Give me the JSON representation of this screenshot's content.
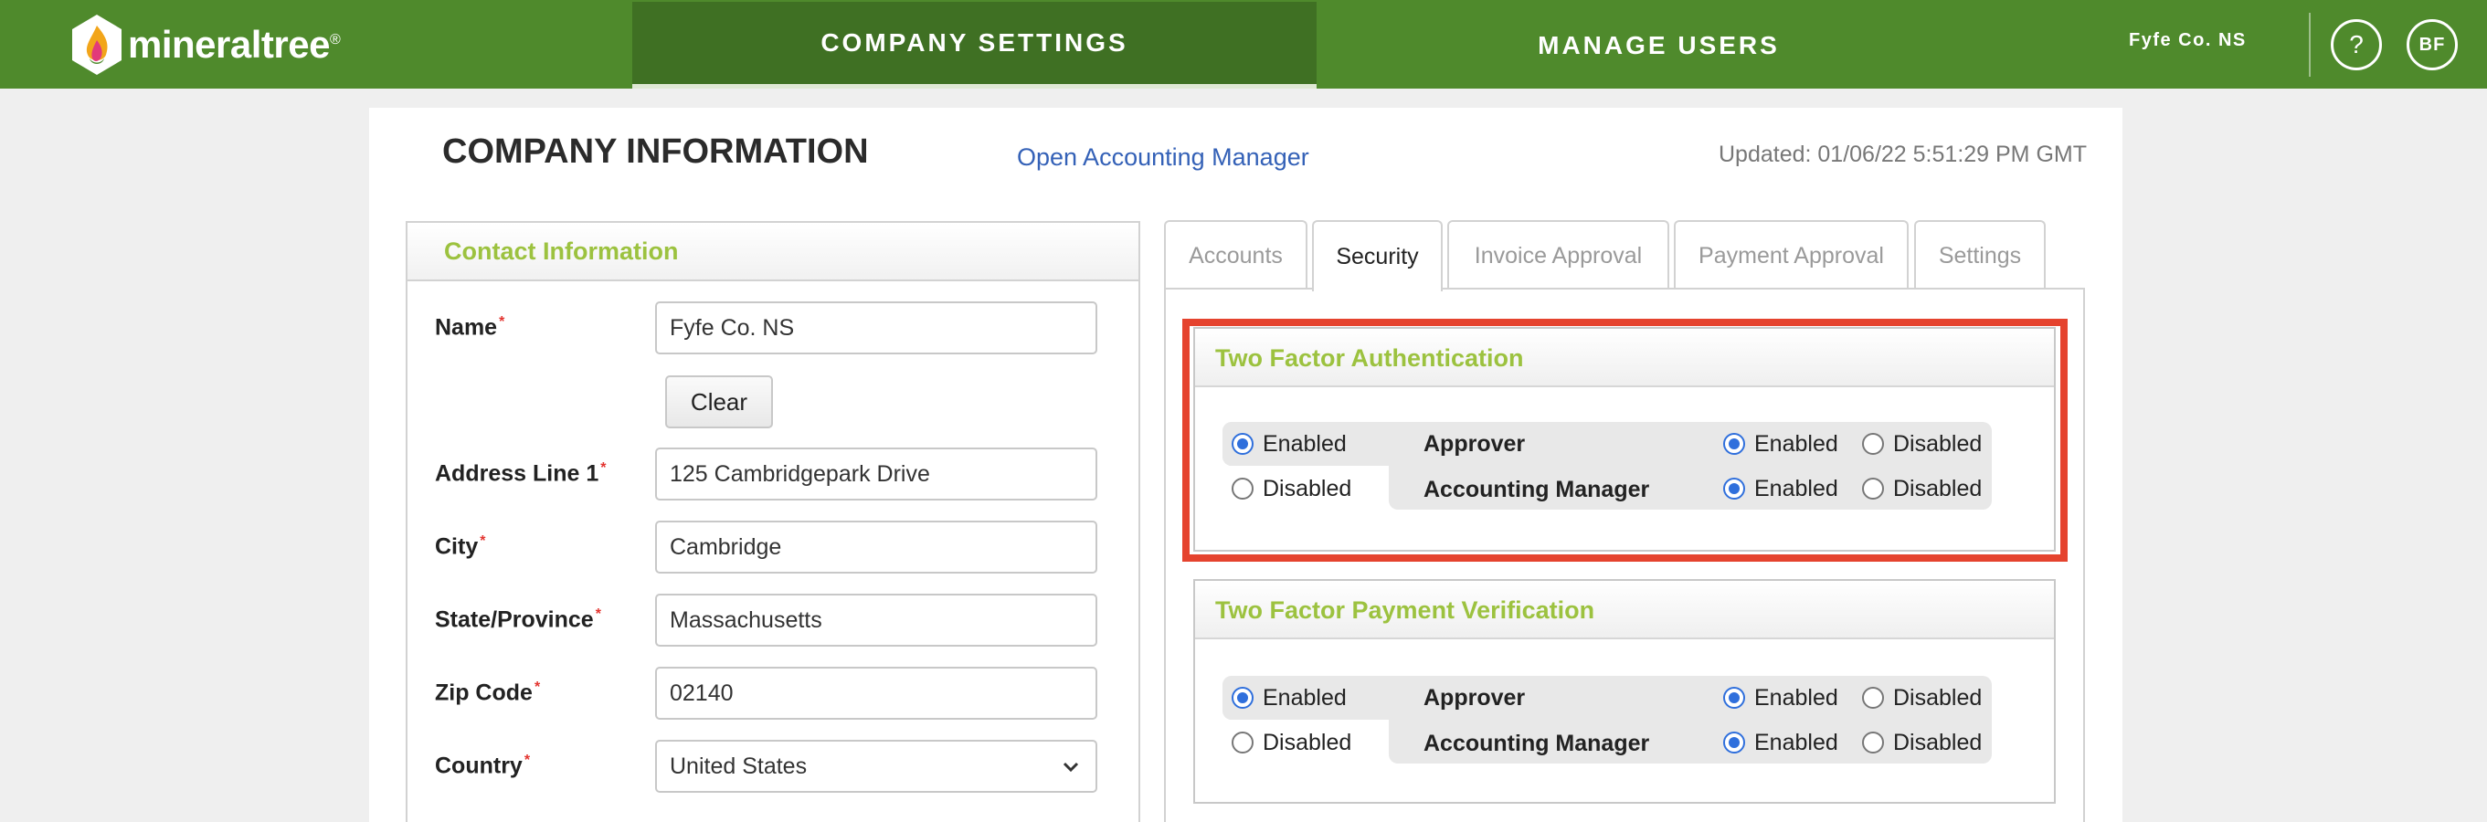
{
  "header": {
    "brand": "mineraltree",
    "brand_mark": "®",
    "nav": {
      "company_settings": "COMPANY SETTINGS",
      "manage_users": "MANAGE USERS"
    },
    "company_name": "Fyfe Co. NS",
    "help_label": "?",
    "avatar_initials": "BF",
    "colors": {
      "bar": "#4f8a2c",
      "active_tab": "#3f7023"
    }
  },
  "page": {
    "title": "COMPANY INFORMATION",
    "accounting_link": "Open Accounting Manager",
    "updated": "Updated: 01/06/22 5:51:29 PM GMT"
  },
  "contact": {
    "title": "Contact Information",
    "required_mark": "*",
    "clear_label": "Clear",
    "fields": {
      "name": {
        "label": "Name",
        "value": "Fyfe Co. NS"
      },
      "address1": {
        "label": "Address Line 1",
        "value": "125 Cambridgepark Drive"
      },
      "city": {
        "label": "City",
        "value": "Cambridge"
      },
      "state": {
        "label": "State/Province",
        "value": "Massachusetts"
      },
      "zip": {
        "label": "Zip Code",
        "value": "02140"
      },
      "country": {
        "label": "Country",
        "value": "United States"
      }
    }
  },
  "tabs": [
    "Accounts",
    "Security",
    "Invoice Approval",
    "Payment Approval",
    "Settings"
  ],
  "active_tab": "Security",
  "security": {
    "sections": [
      {
        "title": "Two Factor Authentication",
        "enabled_label": "Enabled",
        "disabled_label": "Disabled",
        "main_state": "enabled",
        "roles": [
          {
            "label": "Approver",
            "enabled_label": "Enabled",
            "disabled_label": "Disabled",
            "state": "enabled"
          },
          {
            "label": "Accounting Manager",
            "enabled_label": "Enabled",
            "disabled_label": "Disabled",
            "state": "enabled"
          }
        ]
      },
      {
        "title": "Two Factor Payment Verification",
        "enabled_label": "Enabled",
        "disabled_label": "Disabled",
        "main_state": "enabled",
        "roles": [
          {
            "label": "Approver",
            "enabled_label": "Enabled",
            "disabled_label": "Disabled",
            "state": "enabled"
          },
          {
            "label": "Accounting Manager",
            "enabled_label": "Enabled",
            "disabled_label": "Disabled",
            "state": "enabled"
          }
        ]
      }
    ],
    "highlight_color": "#e5432e",
    "section_title_color": "#9cc23f"
  }
}
